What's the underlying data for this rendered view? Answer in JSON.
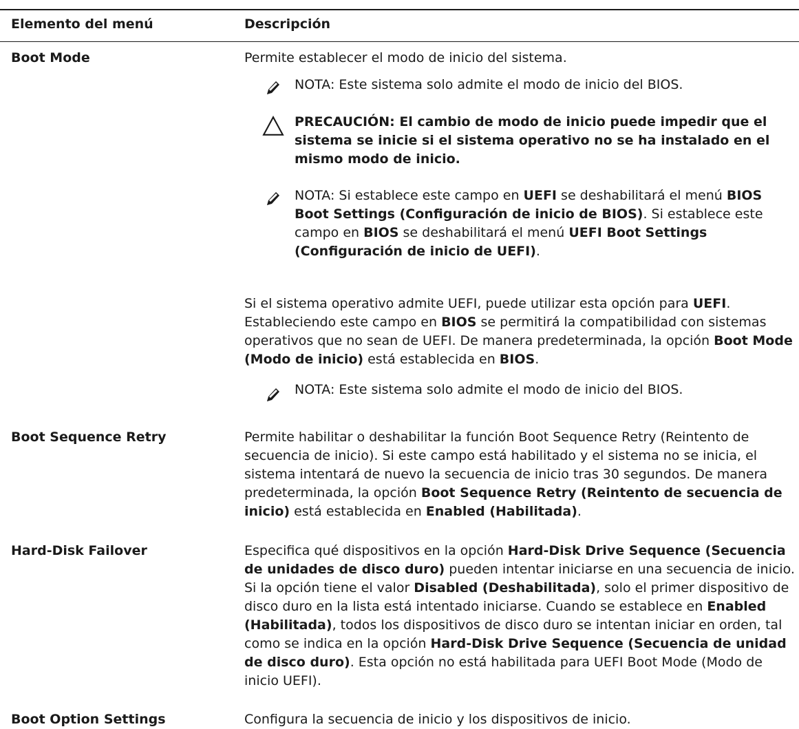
{
  "table": {
    "headers": {
      "item": "Elemento del menú",
      "description": "Descripción"
    }
  },
  "boot_mode": {
    "name": "Boot Mode",
    "intro": "Permite establecer el modo de inicio del sistema.",
    "note1": {
      "label": "NOTA:",
      "text": " Este sistema solo admite el modo de inicio del BIOS."
    },
    "caution": {
      "label": "PRECAUCIÓN:",
      "text": " El cambio de modo de inicio puede impedir que el sistema se inicie si el sistema operativo no se ha instalado en el mismo modo de inicio."
    },
    "note2": {
      "label": "NOTA:",
      "p1": " Si establece este campo en ",
      "b1": "UEFI",
      "p2": " se deshabilitará el menú ",
      "b2": "BIOS Boot Settings (Configuración de inicio de BIOS)",
      "p3": ". Si establece este campo en ",
      "b3": "BIOS",
      "p4": " se deshabilitará el menú ",
      "b4": "UEFI Boot Settings (Configuración de inicio de UEFI)",
      "p5": "."
    },
    "para": {
      "p1": "Si el sistema operativo admite UEFI, puede utilizar esta opción para ",
      "b1": "UEFI",
      "p2": ". Estableciendo este campo en ",
      "b2": "BIOS",
      "p3": " se permitirá la compatibilidad con sistemas operativos que no sean de UEFI. De manera predeterminada, la opción ",
      "b3": "Boot Mode (Modo de inicio)",
      "p4": " está establecida en ",
      "b4": "BIOS",
      "p5": "."
    },
    "note3": {
      "label": "NOTA:",
      "text": " Este sistema solo admite el modo de inicio del BIOS."
    }
  },
  "boot_sequence_retry": {
    "name": "Boot Sequence Retry",
    "p1": "Permite habilitar o deshabilitar la función Boot Sequence Retry (Reintento de secuencia de inicio). Si este campo está habilitado y el sistema no se inicia, el sistema intentará de nuevo la secuencia de inicio tras 30 segundos. De manera predeterminada, la opción ",
    "b1": "Boot Sequence Retry (Reintento de secuencia de inicio)",
    "p2": " está establecida en ",
    "b2": "Enabled (Habilitada)",
    "p3": "."
  },
  "hard_disk_failover": {
    "name": "Hard-Disk Failover",
    "p1": "Especifica qué dispositivos en la opción ",
    "b1": "Hard-Disk Drive Sequence (Secuencia de unidades de disco duro)",
    "p2": " pueden intentar iniciarse en una secuencia de inicio. Si la opción tiene el valor ",
    "b2": "Disabled (Deshabilitada)",
    "p3": ", solo el primer dispositivo de disco duro en la lista está intentado iniciarse. Cuando se establece en ",
    "b3": "Enabled (Habilitada)",
    "p4": ", todos los dispositivos de disco duro se intentan iniciar en orden, tal como se indica en la opción ",
    "b4": "Hard-Disk Drive Sequence (Secuencia de unidad de disco duro)",
    "p5": ". Esta opción no está habilitada para UEFI Boot Mode (Modo de inicio UEFI)."
  },
  "boot_option_settings": {
    "name": "Boot Option Settings",
    "text": "Configura la secuencia de inicio y los dispositivos de inicio."
  },
  "icons": {
    "note": "pencil-note-icon",
    "caution": "warning-triangle-icon"
  }
}
